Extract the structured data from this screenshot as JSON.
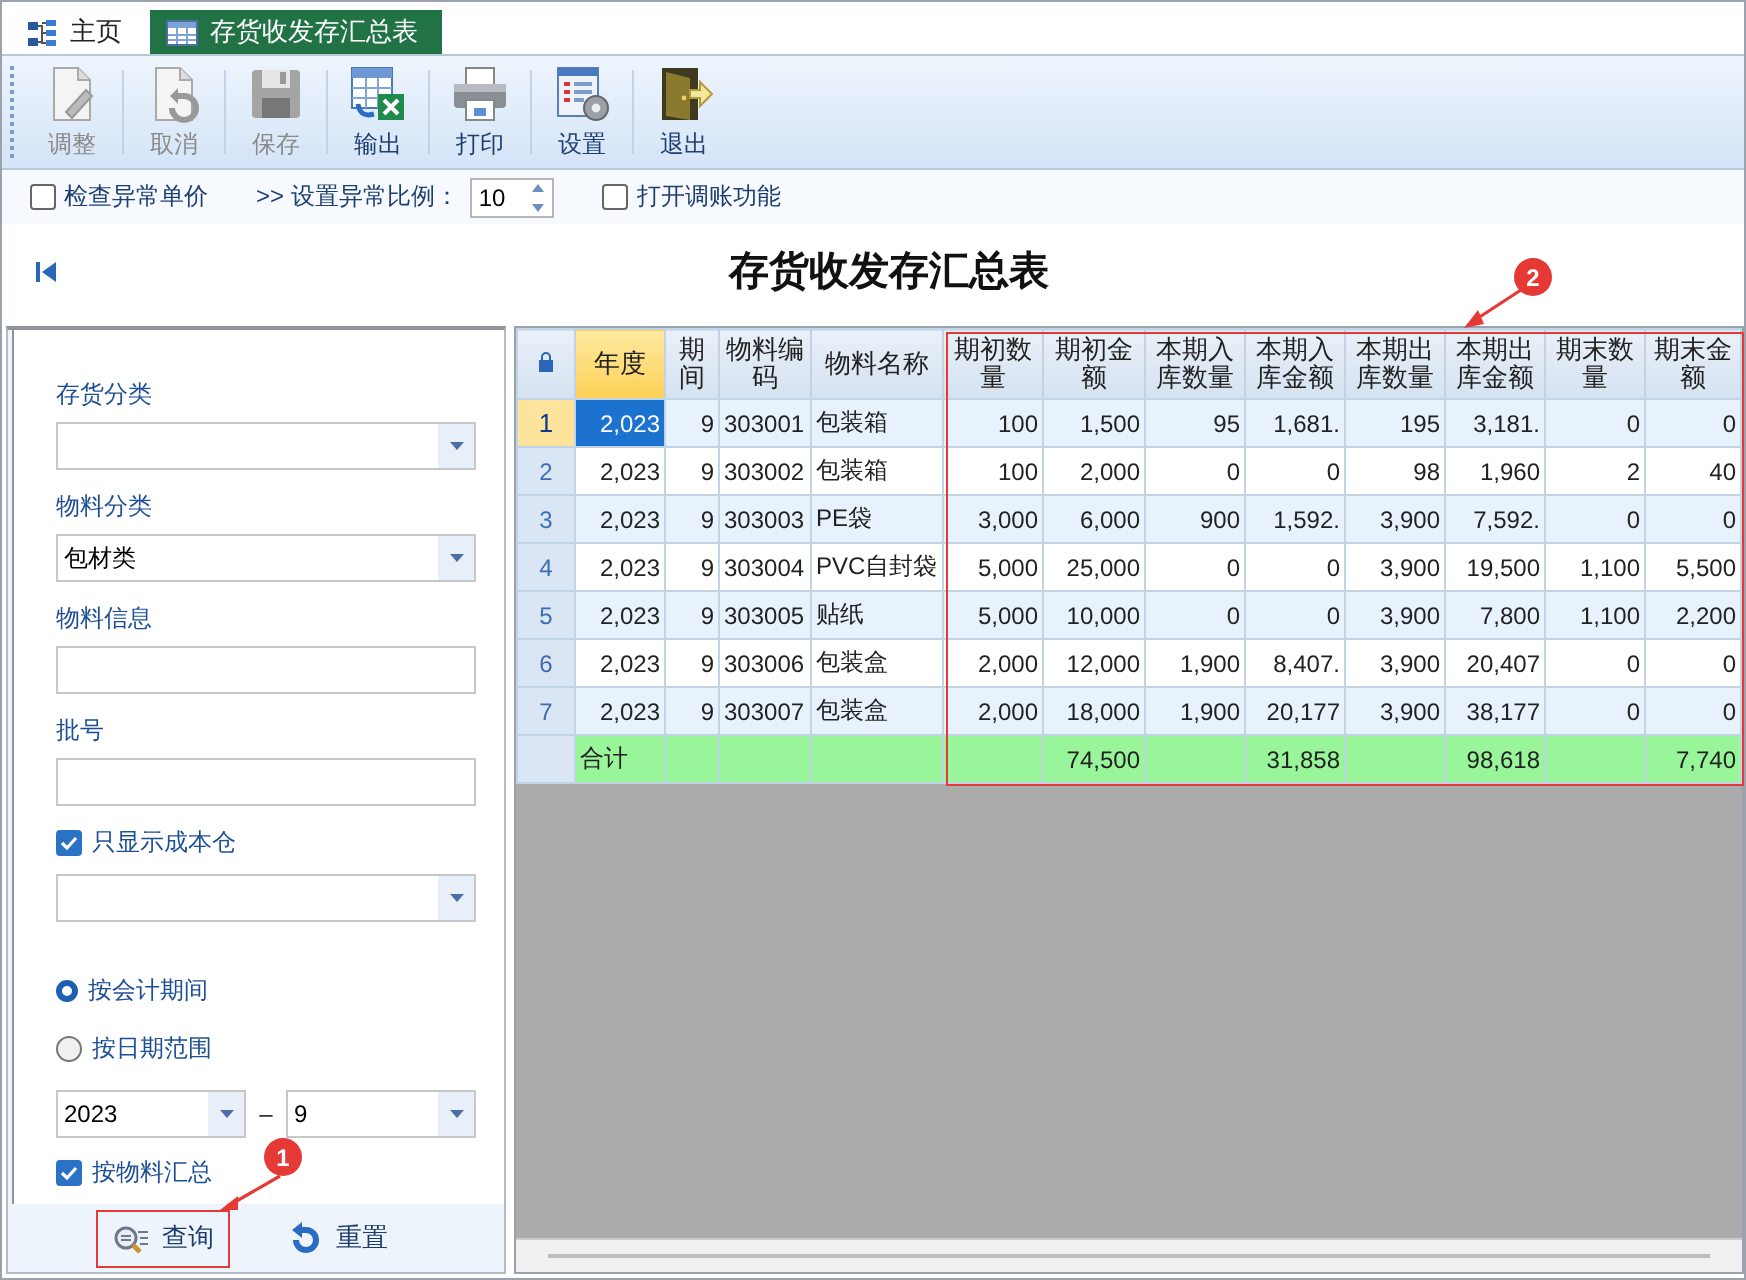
{
  "tabs": [
    {
      "label": "主页",
      "kind": "home",
      "selected": false
    },
    {
      "label": "存货收发存汇总表",
      "kind": "sheet",
      "selected": true
    }
  ],
  "toolbar": [
    {
      "label": "调整",
      "kind": "edit",
      "disabled": true
    },
    {
      "label": "取消",
      "kind": "undo",
      "disabled": true
    },
    {
      "label": "保存",
      "kind": "save",
      "disabled": true
    },
    {
      "label": "输出",
      "kind": "export",
      "disabled": false
    },
    {
      "label": "打印",
      "kind": "print",
      "disabled": false
    },
    {
      "label": "设置",
      "kind": "settings",
      "disabled": false
    },
    {
      "label": "退出",
      "kind": "exit",
      "disabled": false
    }
  ],
  "options": [
    {
      "kind": "checkbox",
      "label": "检查异常单价",
      "checked": false
    },
    {
      "kind": "spinner",
      "label": ">> 设置异常比例：",
      "value": "10"
    },
    {
      "kind": "checkbox",
      "label": "打开调账功能",
      "checked": false
    }
  ],
  "report_title": "存货收发存汇总表",
  "filters": [
    {
      "kind": "select",
      "label": "存货分类"
    },
    {
      "kind": "select",
      "label": "物料分类",
      "value": "包材类"
    },
    {
      "kind": "text",
      "label": "物料信息"
    },
    {
      "kind": "text",
      "label": "批号"
    },
    {
      "kind": "checkbox",
      "label": "只显示成本仓",
      "checked": true
    },
    {
      "kind": "select"
    },
    {
      "kind": "radio",
      "label": "按会计期间",
      "selected": true
    },
    {
      "kind": "radio",
      "label": "按日期范围",
      "selected": false
    },
    {
      "kind": "range",
      "from": "2023",
      "separator": "–",
      "to": "9"
    },
    {
      "kind": "checkbox",
      "label": "按物料汇总",
      "checked": true
    }
  ],
  "buttons": [
    {
      "label": "查询",
      "kind": "search",
      "highlighted": true
    },
    {
      "label": "重置",
      "kind": "reset",
      "highlighted": false
    }
  ],
  "table": {
    "columns": [
      {
        "label": "年度",
        "selected": true,
        "highlighted": false
      },
      {
        "label": "期间",
        "selected": false,
        "highlighted": false
      },
      {
        "label": "物料编码",
        "selected": false,
        "highlighted": false
      },
      {
        "label": "物料名称",
        "selected": false,
        "highlighted": false
      },
      {
        "label": "期初数量",
        "selected": false,
        "highlighted": true
      },
      {
        "label": "期初金额",
        "selected": false,
        "highlighted": true
      },
      {
        "label": "本期入库数量",
        "selected": false,
        "highlighted": true
      },
      {
        "label": "本期入库金额",
        "selected": false,
        "highlighted": true
      },
      {
        "label": "本期出库数量",
        "selected": false,
        "highlighted": true
      },
      {
        "label": "本期出库金额",
        "selected": false,
        "highlighted": true
      },
      {
        "label": "期末数量",
        "selected": false,
        "highlighted": true
      },
      {
        "label": "期末金额",
        "selected": false,
        "highlighted": true
      }
    ],
    "rows": [
      {
        "number": "1",
        "selected": true,
        "cells": [
          "2,023",
          "9",
          "303001",
          "包装箱",
          "100",
          "1,500",
          "95",
          "1,681.",
          "195",
          "3,181.",
          "0",
          "0"
        ]
      },
      {
        "number": "2",
        "selected": false,
        "cells": [
          "2,023",
          "9",
          "303002",
          "包装箱",
          "100",
          "2,000",
          "0",
          "0",
          "98",
          "1,960",
          "2",
          "40"
        ]
      },
      {
        "number": "3",
        "selected": false,
        "cells": [
          "2,023",
          "9",
          "303003",
          "PE袋",
          "3,000",
          "6,000",
          "900",
          "1,592.",
          "3,900",
          "7,592.",
          "0",
          "0"
        ]
      },
      {
        "number": "4",
        "selected": false,
        "cells": [
          "2,023",
          "9",
          "303004",
          "PVC自封袋",
          "5,000",
          "25,000",
          "0",
          "0",
          "3,900",
          "19,500",
          "1,100",
          "5,500"
        ]
      },
      {
        "number": "5",
        "selected": false,
        "cells": [
          "2,023",
          "9",
          "303005",
          "贴纸",
          "5,000",
          "10,000",
          "0",
          "0",
          "3,900",
          "7,800",
          "1,100",
          "2,200"
        ]
      },
      {
        "number": "6",
        "selected": false,
        "cells": [
          "2,023",
          "9",
          "303006",
          "包装盒",
          "2,000",
          "12,000",
          "1,900",
          "8,407.",
          "3,900",
          "20,407",
          "0",
          "0"
        ]
      },
      {
        "number": "7",
        "selected": false,
        "cells": [
          "2,023",
          "9",
          "303007",
          "包装盒",
          "2,000",
          "18,000",
          "1,900",
          "20,177",
          "3,900",
          "38,177",
          "0",
          "0"
        ]
      }
    ],
    "total_row": {
      "label": "合计",
      "cells": [
        "",
        "",
        "",
        "",
        "74,500",
        "",
        "31,858",
        "",
        "98,618",
        "",
        "7,740"
      ]
    }
  },
  "annotations": [
    {
      "label": "1",
      "kind": "query"
    },
    {
      "label": "2",
      "kind": "columns"
    }
  ]
}
